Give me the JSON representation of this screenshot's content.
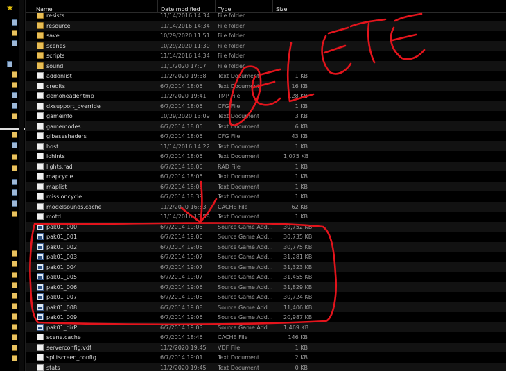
{
  "columns": {
    "name": "Name",
    "date": "Date modified",
    "type": "Type",
    "size": "Size"
  },
  "files": [
    {
      "name": "resists",
      "date": "11/14/2016 14:34",
      "type": "File folder",
      "size": "",
      "icon": "folder"
    },
    {
      "name": "resource",
      "date": "11/14/2016 14:34",
      "type": "File folder",
      "size": "",
      "icon": "folder"
    },
    {
      "name": "save",
      "date": "10/29/2020 11:51",
      "type": "File folder",
      "size": "",
      "icon": "folder"
    },
    {
      "name": "scenes",
      "date": "10/29/2020 11:30",
      "type": "File folder",
      "size": "",
      "icon": "folder"
    },
    {
      "name": "scripts",
      "date": "11/14/2016 14:34",
      "type": "File folder",
      "size": "",
      "icon": "folder"
    },
    {
      "name": "sound",
      "date": "11/1/2020 17:07",
      "type": "File folder",
      "size": "",
      "icon": "folder"
    },
    {
      "name": "addonlist",
      "date": "11/2/2020 19:38",
      "type": "Text Document",
      "size": "1 KB",
      "icon": "doc"
    },
    {
      "name": "credits",
      "date": "6/7/2014 18:05",
      "type": "Text Document",
      "size": "16 KB",
      "icon": "doc"
    },
    {
      "name": "demoheader.tmp",
      "date": "11/2/2020 19:41",
      "type": "TMP File",
      "size": "128 KB",
      "icon": "doc"
    },
    {
      "name": "dxsupport_override",
      "date": "6/7/2014 18:05",
      "type": "CFG File",
      "size": "1 KB",
      "icon": "doc"
    },
    {
      "name": "gameinfo",
      "date": "10/29/2020 13:09",
      "type": "Text Document",
      "size": "3 KB",
      "icon": "doc"
    },
    {
      "name": "gamemodes",
      "date": "6/7/2014 18:05",
      "type": "Text Document",
      "size": "6 KB",
      "icon": "doc"
    },
    {
      "name": "glbaseshaders",
      "date": "6/7/2014 18:05",
      "type": "CFG File",
      "size": "43 KB",
      "icon": "doc"
    },
    {
      "name": "host",
      "date": "11/14/2016 14:22",
      "type": "Text Document",
      "size": "1 KB",
      "icon": "doc"
    },
    {
      "name": "iohints",
      "date": "6/7/2014 18:05",
      "type": "Text Document",
      "size": "1,075 KB",
      "icon": "doc"
    },
    {
      "name": "lights.rad",
      "date": "6/7/2014 18:05",
      "type": "RAD File",
      "size": "1 KB",
      "icon": "doc"
    },
    {
      "name": "mapcycle",
      "date": "6/7/2014 18:05",
      "type": "Text Document",
      "size": "1 KB",
      "icon": "doc"
    },
    {
      "name": "maplist",
      "date": "6/7/2014 18:05",
      "type": "Text Document",
      "size": "1 KB",
      "icon": "doc"
    },
    {
      "name": "missioncycle",
      "date": "6/7/2014 18:39",
      "type": "Text Document",
      "size": "1 KB",
      "icon": "doc"
    },
    {
      "name": "modelsounds.cache",
      "date": "11/2/2020 16:53",
      "type": "CACHE File",
      "size": "62 KB",
      "icon": "doc"
    },
    {
      "name": "motd",
      "date": "11/14/2016 13:58",
      "type": "Text Document",
      "size": "1 KB",
      "icon": "doc"
    },
    {
      "name": "pak01_000",
      "date": "6/7/2014 19:05",
      "type": "Source Game Add...",
      "size": "30,752 KB",
      "icon": "pak"
    },
    {
      "name": "pak01_001",
      "date": "6/7/2014 19:06",
      "type": "Source Game Add...",
      "size": "30,735 KB",
      "icon": "pak"
    },
    {
      "name": "pak01_002",
      "date": "6/7/2014 19:06",
      "type": "Source Game Add...",
      "size": "30,775 KB",
      "icon": "pak"
    },
    {
      "name": "pak01_003",
      "date": "6/7/2014 19:07",
      "type": "Source Game Add...",
      "size": "31,281 KB",
      "icon": "pak"
    },
    {
      "name": "pak01_004",
      "date": "6/7/2014 19:07",
      "type": "Source Game Add...",
      "size": "31,323 KB",
      "icon": "pak"
    },
    {
      "name": "pak01_005",
      "date": "6/7/2014 19:07",
      "type": "Source Game Add...",
      "size": "31,455 KB",
      "icon": "pak"
    },
    {
      "name": "pak01_006",
      "date": "6/7/2014 19:06",
      "type": "Source Game Add...",
      "size": "31,829 KB",
      "icon": "pak"
    },
    {
      "name": "pak01_007",
      "date": "6/7/2014 19:08",
      "type": "Source Game Add...",
      "size": "30,724 KB",
      "icon": "pak"
    },
    {
      "name": "pak01_008",
      "date": "6/7/2014 19:08",
      "type": "Source Game Add...",
      "size": "11,406 KB",
      "icon": "pak"
    },
    {
      "name": "pak01_009",
      "date": "6/7/2014 19:06",
      "type": "Source Game Add...",
      "size": "20,987 KB",
      "icon": "pak"
    },
    {
      "name": "pak01_dirP",
      "date": "6/7/2014 19:03",
      "type": "Source Game Add...",
      "size": "1,469 KB",
      "icon": "pak"
    },
    {
      "name": "scene.cache",
      "date": "6/7/2014 18:46",
      "type": "CACHE File",
      "size": "146 KB",
      "icon": "doc"
    },
    {
      "name": "serverconfig.vdf",
      "date": "11/2/2020 19:45",
      "type": "VDF File",
      "size": "1 KB",
      "icon": "doc"
    },
    {
      "name": "splitscreen_config",
      "date": "6/7/2014 19:01",
      "type": "Text Document",
      "size": "2 KB",
      "icon": "doc"
    },
    {
      "name": "stats",
      "date": "11/2/2020 19:45",
      "type": "Text Document",
      "size": "0 KB",
      "icon": "doc"
    }
  ],
  "annotation": {
    "color": "#e3141c",
    "lettering": "DELETE"
  }
}
